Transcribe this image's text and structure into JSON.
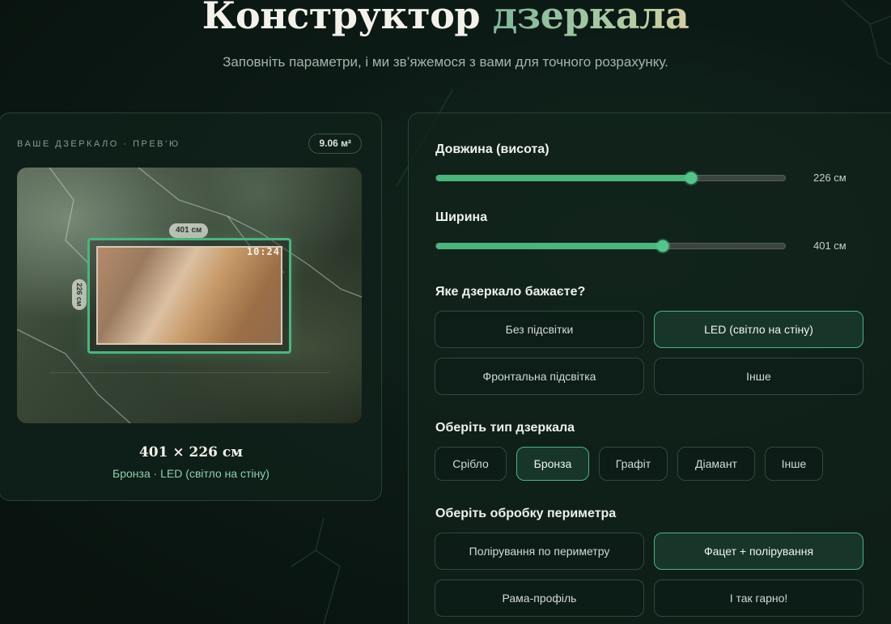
{
  "hero": {
    "title_main": "Конструктор",
    "title_accent": "дзеркала",
    "subtitle": "Заповніть параметри, і ми зв’яжемося з вами для точного розрахунку."
  },
  "preview": {
    "heading": "ВАШЕ ДЗЕРКАЛО · ПРЕВ’Ю",
    "area": "9.06 м²",
    "width_label": "401 см",
    "height_label": "226 см",
    "clock": "10:24",
    "size_title": "401 × 226 см",
    "summary": "Бронза · LED (світло на стіну)"
  },
  "config": {
    "length": {
      "label": "Довжина (висота)",
      "value_text": "226 см",
      "fill_percent": 73
    },
    "width": {
      "label": "Ширина",
      "value_text": "401 см",
      "fill_percent": 65
    },
    "mirror_kind": {
      "label": "Яке дзеркало бажаєте?",
      "options": [
        "Без підсвітки",
        "LED (світло на стіну)",
        "Фронтальна підсвітка",
        "Інше"
      ],
      "selected": "LED (світло на стіну)"
    },
    "mirror_type": {
      "label": "Оберіть тип дзеркала",
      "options": [
        "Срібло",
        "Бронза",
        "Графіт",
        "Діамант",
        "Інше"
      ],
      "selected": "Бронза"
    },
    "edge": {
      "label": "Оберіть обробку периметра",
      "options": [
        "Полірування по периметру",
        "Фацет + полірування",
        "Рама-профіль",
        "І так гарно!"
      ],
      "selected": "Фацет + полірування"
    }
  },
  "colors": {
    "accent": "#4fb37f",
    "background": "#0c1a15"
  }
}
